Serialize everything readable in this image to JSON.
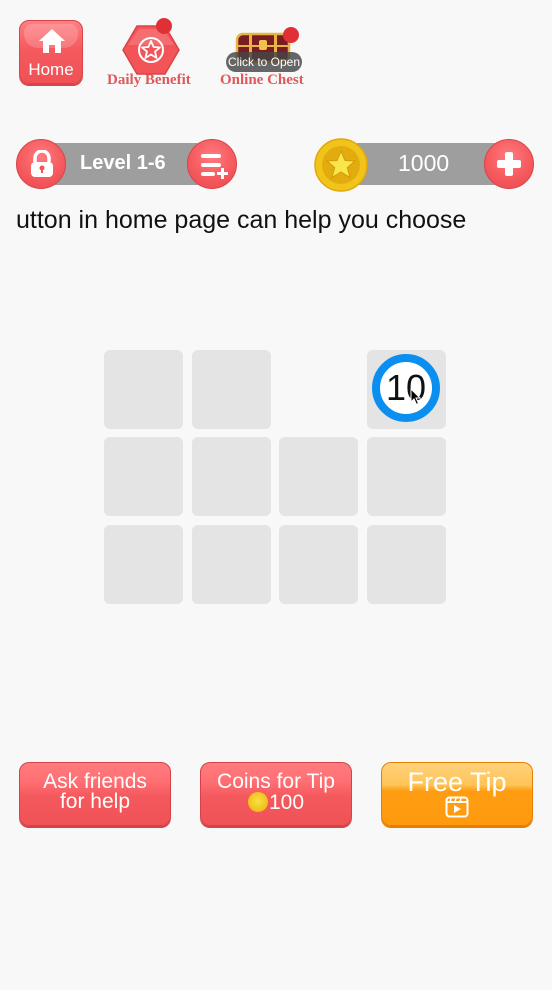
{
  "nav": {
    "home_label": "Home",
    "daily_benefit_label": "Daily Benefit",
    "online_chest_label": "Online Chest",
    "chest_overlay_label": "Click to Open"
  },
  "level_bar": {
    "level_label": "Level 1-6"
  },
  "coin_bar": {
    "coins": "1000"
  },
  "hint_text": "utton in home page can help you choose",
  "grid": {
    "rows": 3,
    "cols": 4,
    "number_tile": {
      "value": "10",
      "row": 1,
      "col": 4,
      "ring_color": "#0a8ff0"
    },
    "empty_slot": {
      "row": 1,
      "col": 3
    }
  },
  "buttons": {
    "ask_friends": {
      "line1": "Ask friends",
      "line2": "for help"
    },
    "coins_for_tip": {
      "line1": "Coins for Tip",
      "cost": "100"
    },
    "free_tip": {
      "line1": "Free Tip",
      "icon": "video-play-icon"
    }
  },
  "colors": {
    "accent_red": "#f45a5e",
    "accent_orange": "#ff9a0e",
    "ring_blue": "#0a8ff0",
    "coin_gold": "#f2c41a"
  }
}
